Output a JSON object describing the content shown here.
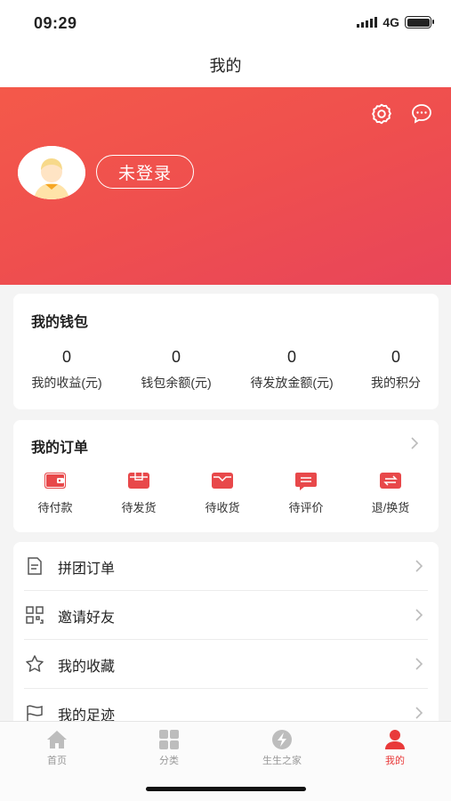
{
  "status_bar": {
    "time": "09:29",
    "network": "4G"
  },
  "header": {
    "title": "我的"
  },
  "profile": {
    "login_label": "未登录",
    "settings_icon": "gear-icon",
    "message_icon": "chat-bubble-icon"
  },
  "wallet": {
    "title": "我的钱包",
    "items": [
      {
        "value": "0",
        "label": "我的收益(元)"
      },
      {
        "value": "0",
        "label": "钱包余额(元)"
      },
      {
        "value": "0",
        "label": "待发放金额(元)"
      },
      {
        "value": "0",
        "label": "我的积分"
      }
    ]
  },
  "orders": {
    "title": "我的订单",
    "items": [
      {
        "label": "待付款",
        "icon": "wallet-icon"
      },
      {
        "label": "待发货",
        "icon": "package-icon"
      },
      {
        "label": "待收货",
        "icon": "inbox-icon"
      },
      {
        "label": "待评价",
        "icon": "comment-icon"
      },
      {
        "label": "退/换货",
        "icon": "exchange-icon"
      }
    ]
  },
  "menu": {
    "items": [
      {
        "label": "拼团订单",
        "icon": "document-icon"
      },
      {
        "label": "邀请好友",
        "icon": "qr-code-icon"
      },
      {
        "label": "我的收藏",
        "icon": "star-icon"
      },
      {
        "label": "我的足迹",
        "icon": "flag-icon"
      }
    ]
  },
  "tab_bar": {
    "items": [
      {
        "label": "首页",
        "icon": "home-icon"
      },
      {
        "label": "分类",
        "icon": "grid-icon"
      },
      {
        "label": "生生之家",
        "icon": "lightning-circle-icon"
      },
      {
        "label": "我的",
        "icon": "user-icon"
      }
    ],
    "active_index": 3
  },
  "colors": {
    "accent": "#e93a3a",
    "hero_start": "#f4594a",
    "hero_end": "#e8455a"
  }
}
